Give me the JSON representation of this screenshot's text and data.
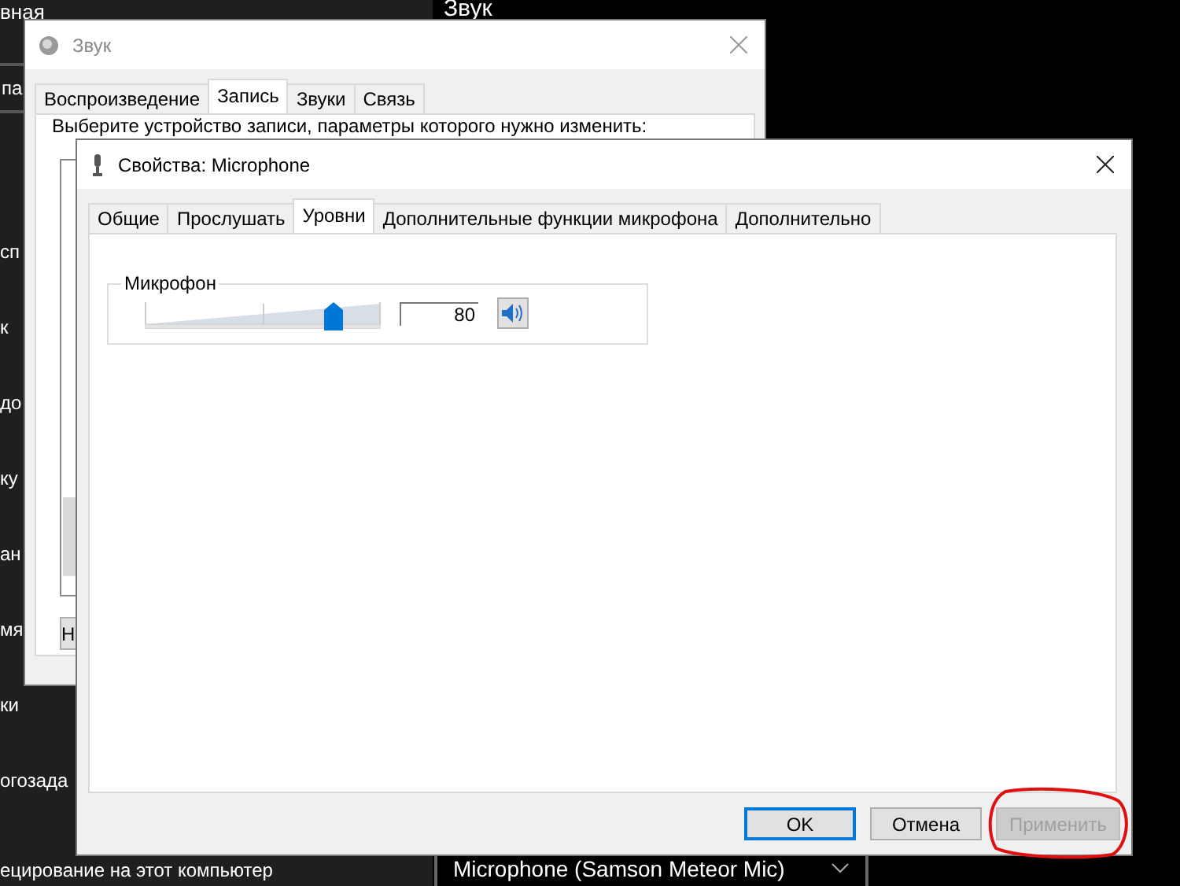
{
  "settings_panel": {
    "header": "вная",
    "search": {
      "value": "па"
    },
    "items": [
      {
        "label": "сп"
      },
      {
        "label": "к"
      },
      {
        "label": "до"
      },
      {
        "label": "ку"
      },
      {
        "label": "ан"
      },
      {
        "label": "мя"
      },
      {
        "label": "ки"
      },
      {
        "label": "огозада"
      },
      {
        "label": "ецирование на этот компьютер"
      }
    ]
  },
  "page_heading": "Звук",
  "device_dropdown": {
    "value": "Microphone (Samson Meteor Mic)"
  },
  "sound_window": {
    "title": "Звук",
    "tabs": [
      {
        "label": "Воспроизведение",
        "selected": false
      },
      {
        "label": "Запись",
        "selected": true
      },
      {
        "label": "Звуки",
        "selected": false
      },
      {
        "label": "Связь",
        "selected": false
      }
    ],
    "instruction": "Выберите устройство записи, параметры которого нужно изменить:",
    "button": "Н"
  },
  "properties_window": {
    "title": "Свойства: Microphone",
    "tabs": [
      {
        "label": "Общие",
        "selected": false
      },
      {
        "label": "Прослушать",
        "selected": false
      },
      {
        "label": "Уровни",
        "selected": true
      },
      {
        "label": "Дополнительные функции микрофона",
        "selected": false
      },
      {
        "label": "Дополнительно",
        "selected": false
      }
    ],
    "group": {
      "label": "Микрофон",
      "level": 0.8,
      "value": "80",
      "muted": false
    },
    "buttons": [
      {
        "label": "OK",
        "kind": "default",
        "disabled": false,
        "highlighted": false
      },
      {
        "label": "Отмена",
        "kind": "normal",
        "disabled": false,
        "highlighted": false
      },
      {
        "label": "Применить",
        "kind": "normal",
        "disabled": true,
        "highlighted": true
      }
    ]
  }
}
